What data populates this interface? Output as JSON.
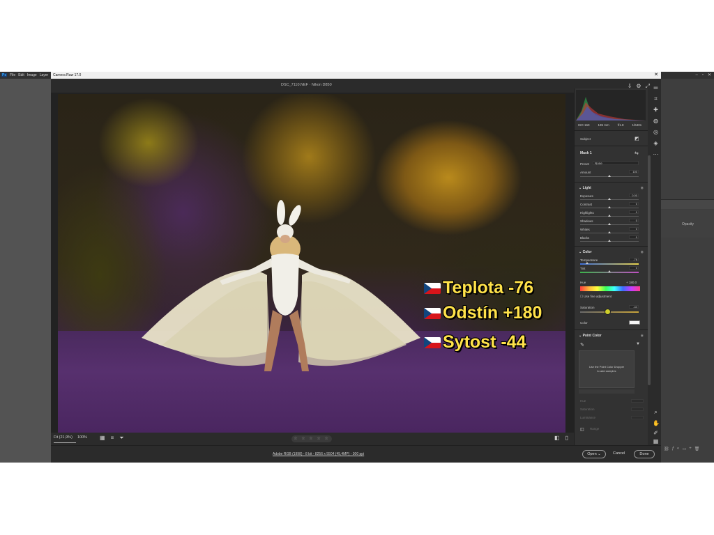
{
  "photoshop": {
    "menu": [
      "File",
      "Edit",
      "Image",
      "Layer"
    ],
    "logo": "Ps",
    "right_panel": {
      "window_controls": [
        "–",
        "▫",
        "✕"
      ],
      "label": "Opacity"
    }
  },
  "window": {
    "title": "Camera Raw 17.0",
    "close": "✕"
  },
  "header": {
    "file_title": "DSC_7110.NEF  ·  Nikon D850"
  },
  "histogram": {
    "info": [
      "ISO 160",
      "135 mm",
      "f/1.8",
      "1/640s"
    ]
  },
  "panel": {
    "subject": "Subject",
    "mask": "Mask 1",
    "preset_label": "Preset",
    "preset_value": "None",
    "amount_label": "Amount",
    "amount_value": "100",
    "light": {
      "title": "Light",
      "sliders": [
        {
          "label": "Exposure",
          "value": "0.00",
          "pos": 0.5
        },
        {
          "label": "Contrast",
          "value": "0",
          "pos": 0.5
        },
        {
          "label": "Highlights",
          "value": "0",
          "pos": 0.5
        },
        {
          "label": "Shadows",
          "value": "0",
          "pos": 0.5
        },
        {
          "label": "Whites",
          "value": "0",
          "pos": 0.5
        },
        {
          "label": "Blacks",
          "value": "0",
          "pos": 0.5
        }
      ]
    },
    "color": {
      "title": "Color",
      "temperature_label": "Temperature",
      "temperature_value": "-76",
      "temperature_pos": 0.12,
      "tint_label": "Tint",
      "tint_value": "0",
      "tint_pos": 0.5,
      "hue_label": "Hue",
      "hue_value": "+ 180.0",
      "fine_adjust": "Use fine adjustment",
      "saturation_label": "Saturation",
      "saturation_value": "-44",
      "saturation_pos": 0.47,
      "color_label": "Color"
    },
    "point_color": {
      "title": "Point Color",
      "box_text_1": "Use the Point Color Dropper",
      "box_text_2": "to add samples",
      "dim_labels": [
        "Hue",
        "Saturation",
        "Luminance"
      ],
      "range_label": "Range"
    }
  },
  "overlay": {
    "lines": [
      "Teplota -76",
      "Odstín +180",
      "Sytost -44"
    ],
    "text_color": "#ffe24a",
    "flag_colors": [
      "#ffffff",
      "#d7141a",
      "#11457e"
    ]
  },
  "toolbar": {
    "fit": "Fit (21,9%)",
    "zoom": "100%",
    "stars": "☆ ☆ ☆ ☆ ☆"
  },
  "footer": {
    "info": "Adobe RGB (1998) - 8 bit - 8256 x 5504 (45,4MP) - 300 ppi",
    "open": "Open",
    "cancel": "Cancel",
    "done": "Done"
  },
  "icons": {
    "header": [
      "save-icon",
      "gear-icon",
      "expand-icon"
    ],
    "tools": [
      "edit-icon",
      "crop-icon",
      "heal-icon",
      "mask-icon",
      "redeye-icon",
      "presets-icon",
      "more-icon",
      "zoom-icon",
      "hand-icon",
      "eyedropper-icon",
      "grid-icon"
    ]
  }
}
